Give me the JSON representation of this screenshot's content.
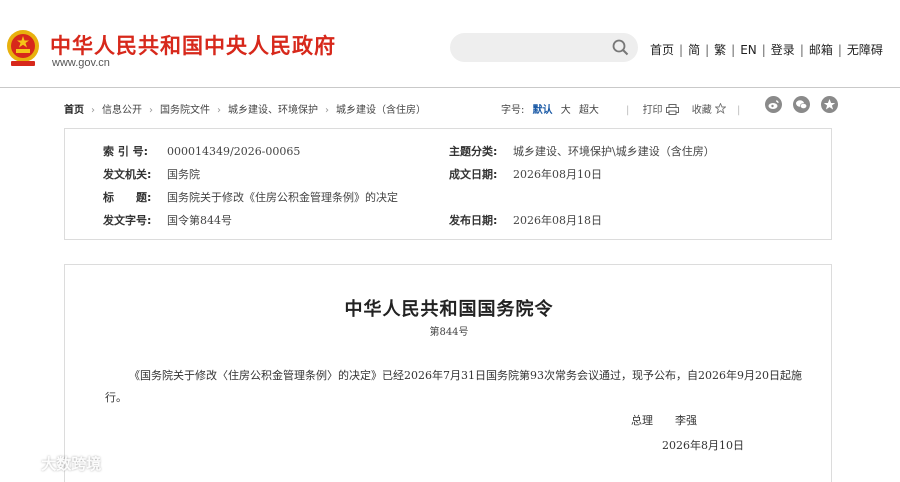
{
  "header": {
    "site_title": "中华人民共和国中央人民政府",
    "site_domain": "www.gov.cn",
    "search": {
      "placeholder": ""
    },
    "nav": [
      "首页",
      "简",
      "繁",
      "EN",
      "登录",
      "邮箱",
      "无障碍"
    ]
  },
  "breadcrumb": {
    "items": [
      "首页",
      "信息公开",
      "国务院文件",
      "城乡建设、环境保护",
      "城乡建设（含住房）"
    ],
    "font_size_label": "字号:",
    "font_sizes": [
      "默认",
      "大",
      "超大"
    ],
    "print_label": "打印",
    "favorite_label": "收藏"
  },
  "info": {
    "index_label": "索 引 号:",
    "index_value": "000014349/2026-00065",
    "topic_label": "主题分类:",
    "topic_value": "城乡建设、环境保护\\城乡建设（含住房）",
    "issuer_label": "发文机关:",
    "issuer_value": "国务院",
    "written_date_label": "成文日期:",
    "written_date_value": "2026年08月10日",
    "title_label": "标　　题:",
    "title_value": "国务院关于修改《住房公积金管理条例》的决定",
    "doc_no_label": "发文字号:",
    "doc_no_value": "国令第844号",
    "publish_date_label": "发布日期:",
    "publish_date_value": "2026年08月18日"
  },
  "document": {
    "title": "中华人民共和国国务院令",
    "number": "第844号",
    "body": "《国务院关于修改〈住房公积金管理条例〉的决定》已经2026年7月31日国务院第93次常务会议通过，现予公布，自2026年9月20日起施行。",
    "sign_title": "总理",
    "sign_name": "李强",
    "date": "2026年8月10日"
  },
  "watermark": "大数跨境",
  "colors": {
    "brand_red": "#d7281b",
    "link_blue": "#1b5aa6"
  }
}
